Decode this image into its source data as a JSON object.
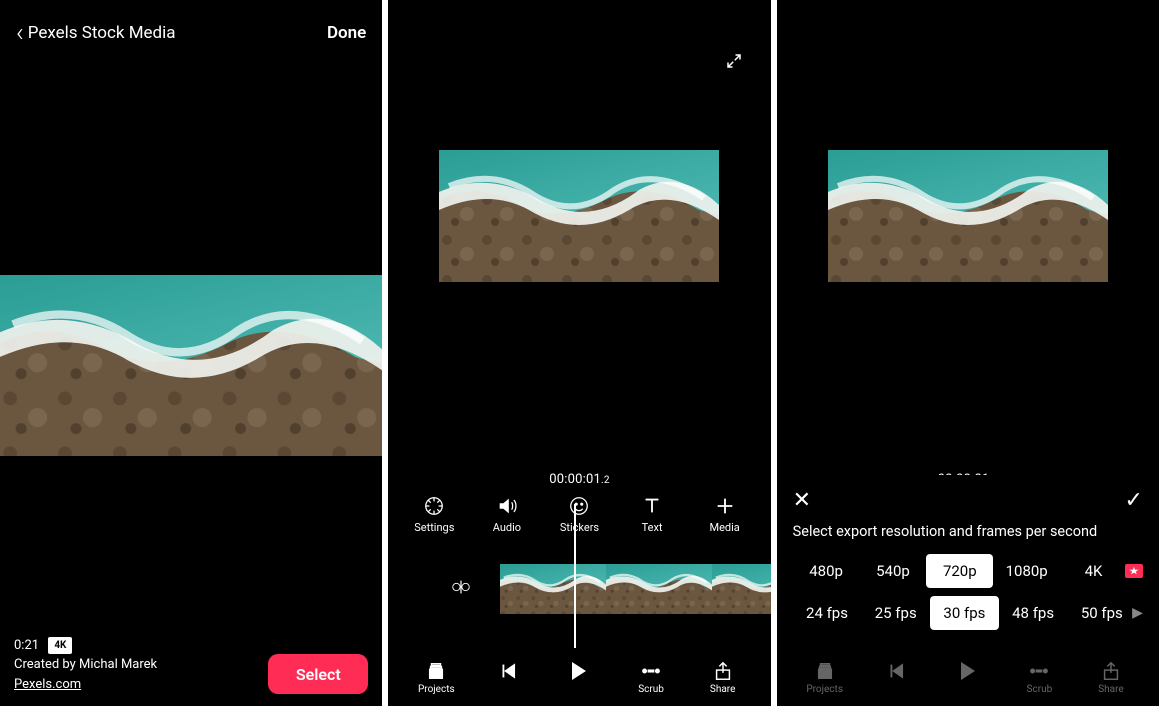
{
  "screen1": {
    "back_label": "Pexels Stock Media",
    "done_label": "Done",
    "duration": "0:21",
    "badge": "4K",
    "credit": "Created by Michal Marek",
    "source": "Pexels.com",
    "select_label": "Select"
  },
  "editor": {
    "timestamp_main": "00:00:01",
    "timestamp_frac": ".2",
    "tools": [
      {
        "label": "Settings",
        "icon": "settings-icon"
      },
      {
        "label": "Audio",
        "icon": "audio-icon"
      },
      {
        "label": "Stickers",
        "icon": "stickers-icon"
      },
      {
        "label": "Text",
        "icon": "text-icon"
      },
      {
        "label": "Media",
        "icon": "media-icon"
      }
    ],
    "bottombar": [
      {
        "label": "Projects",
        "icon": "projects-icon"
      },
      {
        "label": "",
        "icon": "prev-icon"
      },
      {
        "label": "",
        "icon": "play-icon"
      },
      {
        "label": "Scrub",
        "icon": "scrub-icon"
      },
      {
        "label": "Share",
        "icon": "share-icon"
      }
    ]
  },
  "export": {
    "title": "Select export resolution and frames per second",
    "resolutions": [
      "480p",
      "540p",
      "720p",
      "1080p",
      "4K"
    ],
    "selected_res": "720p",
    "fps": [
      "24 fps",
      "25 fps",
      "30 fps",
      "48 fps",
      "50 fps"
    ],
    "selected_fps": "30 fps"
  }
}
